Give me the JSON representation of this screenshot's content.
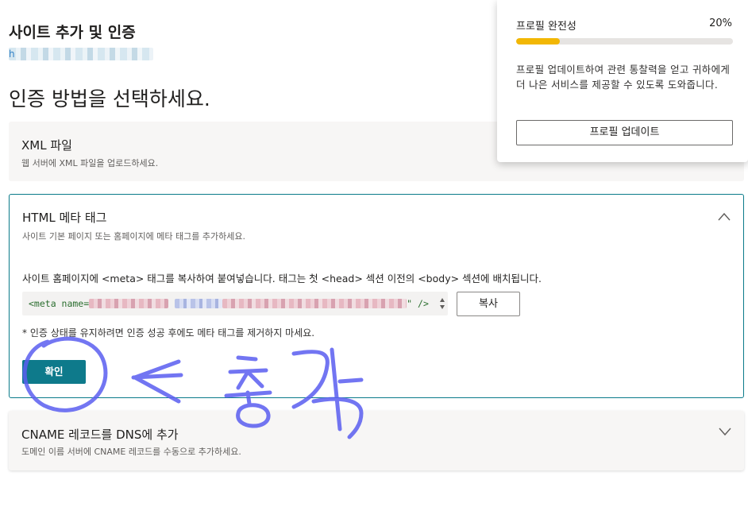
{
  "header": {
    "page_title": "사이트 추가 및 인증",
    "site_url_prefix": "h"
  },
  "section_heading": "인증 방법을 선택하세요.",
  "methods": {
    "xml": {
      "title": "XML 파일",
      "description": "웹 서버에 XML 파일을 업로드하세요."
    },
    "html_meta": {
      "title": "HTML 메타 태그",
      "description": "사이트 기본 페이지 또는 홈페이지에 메타 태그를 추가하세요.",
      "instruction": "사이트 홈페이지에 <meta> 태그를 복사하여 붙여넣습니다. 태그는 첫 <head> 섹션 이전의 <body> 섹션에 배치됩니다.",
      "code_prefix": "<meta name=",
      "code_suffix": "\" />",
      "copy_label": "복사",
      "note": "* 인증 상태를 유지하려면 인증 성공 후에도 메타 태그를 제거하지 마세요.",
      "confirm_label": "확인",
      "expanded": true
    },
    "cname": {
      "title": "CNAME 레코드를 DNS에 추가",
      "description": "도메인 이름 서버에 CNAME 레코드를 수동으로 추가하세요."
    }
  },
  "profile_panel": {
    "title": "프로필 완전성",
    "percent_label": "20%",
    "progress_fraction": 0.2,
    "description": "프로필 업데이트하여 관련 통찰력을 얻고 귀하에게 더 나은 서비스를 제공할 수 있도록 도와줍니다.",
    "button_label": "프로필 업데이트"
  },
  "colors": {
    "accent": "#0e7a8b",
    "progress": "#f2b705",
    "annotation": "#5a5ef0"
  },
  "icons": {
    "chevron_up": "chevron-up-icon",
    "chevron_down": "chevron-down-icon"
  }
}
